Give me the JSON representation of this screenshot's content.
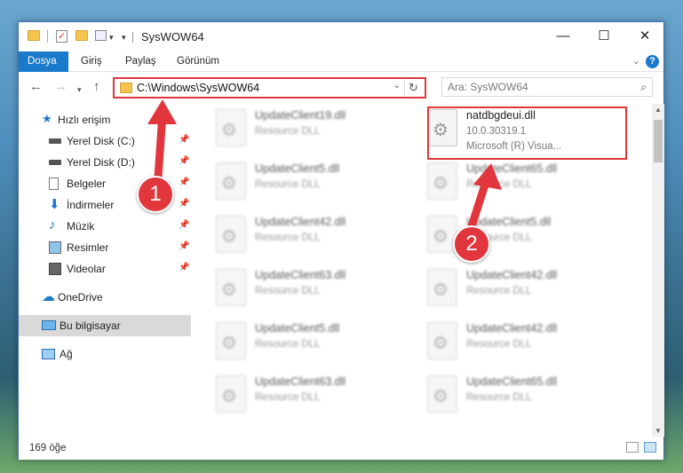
{
  "title": "SysWOW64",
  "ribbon_tabs": [
    "Dosya",
    "Giriş",
    "Paylaş",
    "Görünüm"
  ],
  "address": "C:\\Windows\\SysWOW64",
  "search_placeholder": "Ara: SysWOW64",
  "sidebar": [
    {
      "label": "Hızlı erişim",
      "icon": "star-icon"
    },
    {
      "label": "Yerel Disk (C:)",
      "icon": "drive-icon"
    },
    {
      "label": "Yerel Disk (D:)",
      "icon": "drive-icon"
    },
    {
      "label": "Belgeler",
      "icon": "documents-icon"
    },
    {
      "label": "İndirmeler",
      "icon": "download-icon"
    },
    {
      "label": "Müzik",
      "icon": "music-icon"
    },
    {
      "label": "Resimler",
      "icon": "pictures-icon"
    },
    {
      "label": "Videolar",
      "icon": "videos-icon"
    },
    {
      "label": "OneDrive",
      "icon": "cloud-icon"
    },
    {
      "label": "Bu bilgisayar",
      "icon": "computer-icon"
    },
    {
      "label": "Ağ",
      "icon": "network-icon"
    }
  ],
  "files_left": [
    {
      "name": "UpdateClient19.dll",
      "desc": "Resource DLL"
    },
    {
      "name": "UpdateClient5.dll",
      "desc": "Resource DLL"
    },
    {
      "name": "UpdateClient42.dll",
      "desc": "Resource DLL"
    },
    {
      "name": "UpdateClient63.dll",
      "desc": "Resource DLL"
    },
    {
      "name": "UpdateClient5.dll",
      "desc": "Resource DLL"
    },
    {
      "name": "UpdateClient63.dll",
      "desc": "Resource DLL"
    }
  ],
  "highlight_file": {
    "name": "natdbgdeui.dll",
    "version": "10.0.30319.1",
    "desc": "Microsoft (R) Visua..."
  },
  "files_right": [
    {
      "name": "UpdateClient65.dll",
      "desc": "Resource DLL"
    },
    {
      "name": "UpdateClient5.dll",
      "desc": "Resource DLL"
    },
    {
      "name": "UpdateClient42.dll",
      "desc": "Resource DLL"
    },
    {
      "name": "UpdateClient42.dll",
      "desc": "Resource DLL"
    },
    {
      "name": "UpdateClient65.dll",
      "desc": "Resource DLL"
    }
  ],
  "status": "169 öğe",
  "callouts": [
    "1",
    "2"
  ],
  "colors": {
    "accent": "#1979ca",
    "callout": "#e0363c"
  }
}
